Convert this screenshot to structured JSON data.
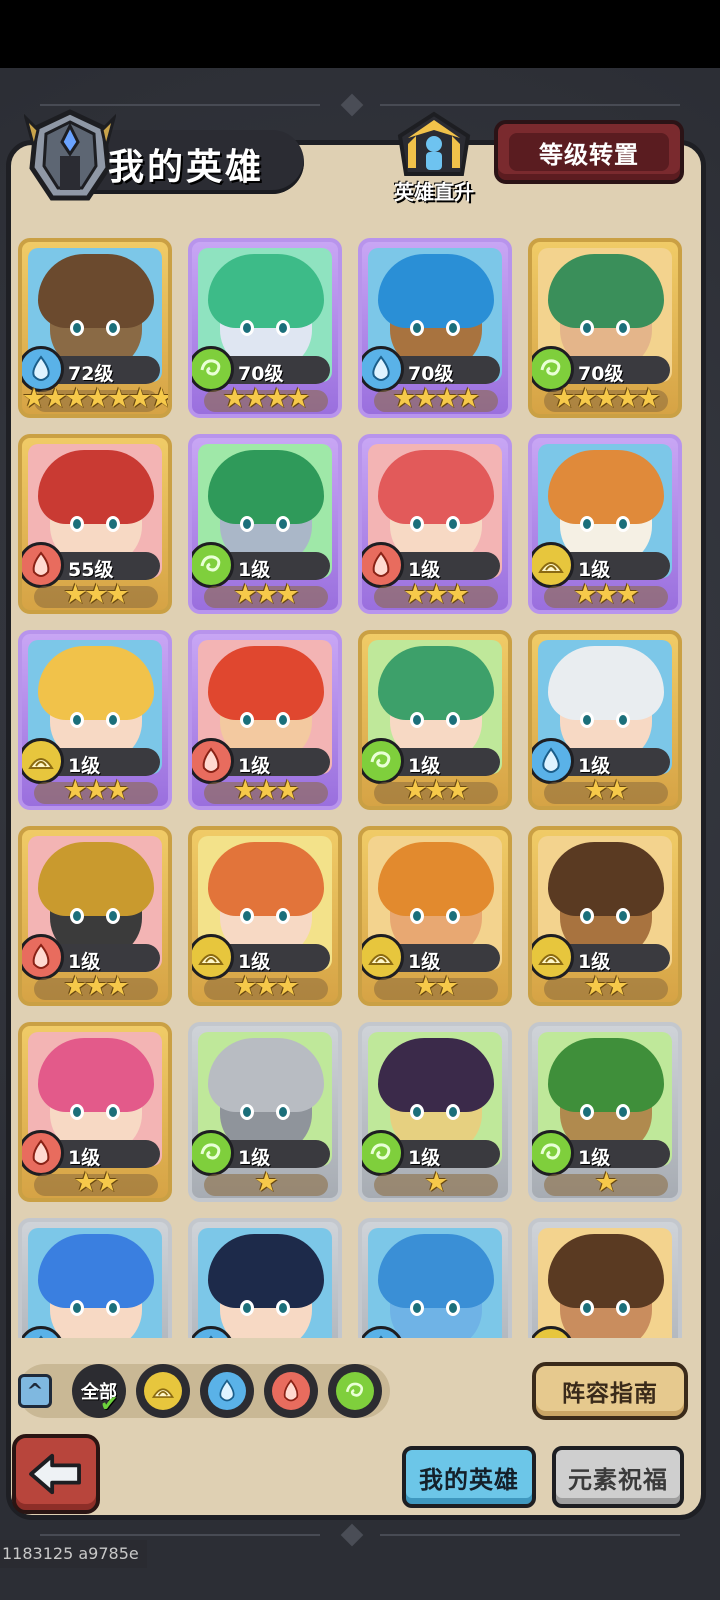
{
  "header": {
    "title": "我的英雄",
    "upgrade_label": "英雄直升",
    "transfer_label": "等级转置"
  },
  "heroes": [
    {
      "level": "72级",
      "element": "water",
      "frame": "gold",
      "stars": "★★★★★★★",
      "hair": "#6b4a2e",
      "skin": "#8a6a45",
      "bg": "#7cc7e8"
    },
    {
      "level": "70级",
      "element": "wind",
      "frame": "purple",
      "stars": "★★★★",
      "hair": "#3dbb88",
      "skin": "#dfe6f2",
      "bg": "#8fe3c0"
    },
    {
      "level": "70级",
      "element": "water",
      "frame": "purple",
      "stars": "★★★★",
      "hair": "#2a8fd6",
      "skin": "#a8733f",
      "bg": "#7cc7e8"
    },
    {
      "level": "70级",
      "element": "wind",
      "frame": "gold",
      "stars": "★★★★★",
      "hair": "#3a8f5a",
      "skin": "#e4b58a",
      "bg": "#f3d38e"
    },
    {
      "level": "55级",
      "element": "fire",
      "frame": "gold",
      "stars": "★★★",
      "hair": "#c93a33",
      "skin": "#f7d9c4",
      "bg": "#f3b4b4"
    },
    {
      "level": "1级",
      "element": "wind",
      "frame": "purple",
      "stars": "★★★",
      "hair": "#2f9a5a",
      "skin": "#aab7c8",
      "bg": "#9fe8a8"
    },
    {
      "level": "1级",
      "element": "fire",
      "frame": "purple",
      "stars": "★★★",
      "hair": "#e25a5a",
      "skin": "#f7d9c4",
      "bg": "#f3b4b4"
    },
    {
      "level": "1级",
      "element": "earth",
      "frame": "purple",
      "stars": "★★★",
      "hair": "#e08a3a",
      "skin": "#f5f0e4",
      "bg": "#7cc7e8"
    },
    {
      "level": "1级",
      "element": "earth",
      "frame": "purple",
      "stars": "★★★",
      "hair": "#f1c24a",
      "skin": "#f7d9c4",
      "bg": "#7cc7e8"
    },
    {
      "level": "1级",
      "element": "fire",
      "frame": "purple",
      "stars": "★★★",
      "hair": "#e0472f",
      "skin": "#f3c9a0",
      "bg": "#f3b4b4"
    },
    {
      "level": "1级",
      "element": "wind",
      "frame": "gold",
      "stars": "★★★",
      "hair": "#3da06a",
      "skin": "#f7d9c4",
      "bg": "#bfe89a"
    },
    {
      "level": "1级",
      "element": "water",
      "frame": "gold",
      "stars": "★★",
      "hair": "#e9edf0",
      "skin": "#f7d9c4",
      "bg": "#7cc7e8"
    },
    {
      "level": "1级",
      "element": "fire",
      "frame": "gold",
      "stars": "★★★",
      "hair": "#c99a2e",
      "skin": "#3b3b3b",
      "bg": "#f3b4b4"
    },
    {
      "level": "1级",
      "element": "earth",
      "frame": "gold",
      "stars": "★★★",
      "hair": "#e2743a",
      "skin": "#f7d9c4",
      "bg": "#f3e28a"
    },
    {
      "level": "1级",
      "element": "earth",
      "frame": "gold",
      "stars": "★★",
      "hair": "#e28a2e",
      "skin": "#e8a872",
      "bg": "#f3d38e"
    },
    {
      "level": "1级",
      "element": "earth",
      "frame": "gold",
      "stars": "★★",
      "hair": "#5a3a22",
      "skin": "#a8733f",
      "bg": "#f3d38e"
    },
    {
      "level": "1级",
      "element": "fire",
      "frame": "gold",
      "stars": "★★",
      "hair": "#e35a8a",
      "skin": "#f7d9c4",
      "bg": "#f3b4b4"
    },
    {
      "level": "1级",
      "element": "wind",
      "frame": "silver",
      "stars": "★",
      "hair": "#b8bcc2",
      "skin": "#8f949b",
      "bg": "#bfe89a"
    },
    {
      "level": "1级",
      "element": "wind",
      "frame": "silver",
      "stars": "★",
      "hair": "#3b2a4a",
      "skin": "#e6d080",
      "bg": "#bfe89a"
    },
    {
      "level": "1级",
      "element": "wind",
      "frame": "silver",
      "stars": "★",
      "hair": "#3f8f3a",
      "skin": "#b08a4e",
      "bg": "#bfe89a"
    },
    {
      "level": "",
      "element": "water",
      "frame": "silver",
      "stars": "",
      "hair": "#3a7fe0",
      "skin": "#f7d9c4",
      "bg": "#7cc7e8"
    },
    {
      "level": "",
      "element": "water",
      "frame": "silver",
      "stars": "",
      "hair": "#1d2a4a",
      "skin": "#f7d9c4",
      "bg": "#7cc7e8"
    },
    {
      "level": "",
      "element": "water",
      "frame": "silver",
      "stars": "",
      "hair": "#3a8fd6",
      "skin": "#6fb3e6",
      "bg": "#7cc7e8"
    },
    {
      "level": "",
      "element": "earth",
      "frame": "silver",
      "stars": "",
      "hair": "#5a3a22",
      "skin": "#c98d5e",
      "bg": "#f3d38e"
    }
  ],
  "filters": {
    "all_label": "全部",
    "elements": [
      "earth",
      "water",
      "fire",
      "wind"
    ]
  },
  "buttons": {
    "guide_label": "阵容指南"
  },
  "tabs": {
    "my_heroes": "我的英雄",
    "blessing": "元素祝福"
  },
  "version": "1183125 a9785e",
  "colors": {
    "water": "#5ab2e8",
    "wind": "#7fcf3c",
    "fire": "#e86c5e",
    "earth": "#e7c63d",
    "panel": "#dfd0b3",
    "gold_frame": "#caa044",
    "purple_frame": "#b894ec",
    "silver_frame": "#c3c7cd"
  }
}
